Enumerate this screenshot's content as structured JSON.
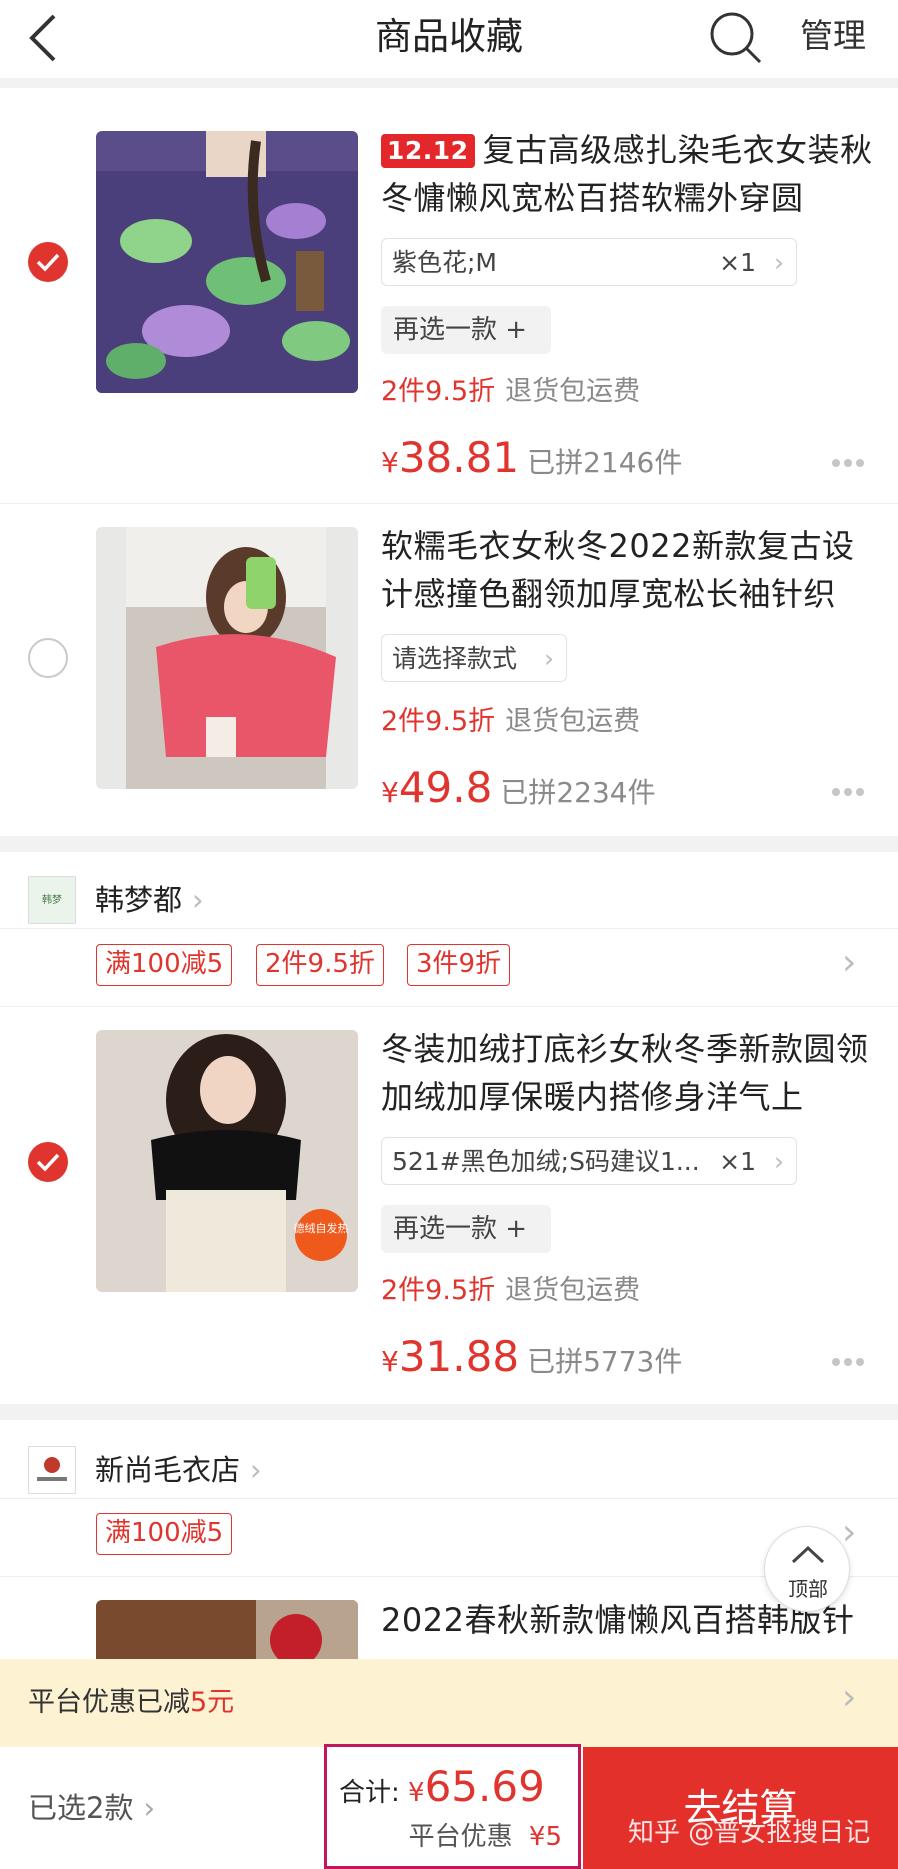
{
  "header": {
    "title": "商品收藏",
    "manage": "管理"
  },
  "items": [
    {
      "checked": true,
      "badge": "12.12",
      "title": "复古高级感扎染毛衣女装秋冬慵懒风宽松百搭软糯外穿圆",
      "sku": "紫色花;M",
      "qty": "×1",
      "reselect": "再选一款 +",
      "promo": "2件9.5折",
      "promo_note": "退货包运费",
      "currency": "¥",
      "price": "38.81",
      "sold": "已拼2146件"
    },
    {
      "checked": false,
      "title": "软糯毛衣女秋冬2022新款复古设计感撞色翻领加厚宽松长袖针织",
      "sku": "请选择款式",
      "promo": "2件9.5折",
      "promo_note": "退货包运费",
      "currency": "¥",
      "price": "49.8",
      "sold": "已拼2234件"
    },
    {
      "checked": true,
      "title": "冬装加绒打底衫女秋冬季新款圆领加绒加厚保暖内搭修身洋气上",
      "sku": "521#黑色加绒;S码建议1...",
      "qty": "×1",
      "reselect": "再选一款 +",
      "promo": "2件9.5折",
      "promo_note": "退货包运费",
      "currency": "¥",
      "price": "31.88",
      "sold": "已拼5773件",
      "thumb_badge": "德绒自发热"
    },
    {
      "title": "2022春秋新款慵懒风百搭韩版针"
    }
  ],
  "shops": [
    {
      "name": "韩梦都",
      "logo_text": "韩梦",
      "tags": [
        "满100减5",
        "2件9.5折",
        "3件9折"
      ]
    },
    {
      "name": "新尚毛衣店",
      "tags": [
        "满100减5"
      ]
    }
  ],
  "to_top": "顶部",
  "banner": {
    "text": "平台优惠已减",
    "amount": "5元"
  },
  "footer": {
    "selected": "已选2款",
    "total_label": "合计:",
    "currency": "¥",
    "total": "65.69",
    "discount_label": "平台优惠",
    "discount": "¥5",
    "checkout": "去结算",
    "watermark": "知乎 @普女抠搜日记"
  },
  "colors": {
    "accent": "#e0342e",
    "checkout_bg": "#e4302b",
    "banner_bg": "#fdf3d3",
    "highlight_border": "#c2185b"
  }
}
